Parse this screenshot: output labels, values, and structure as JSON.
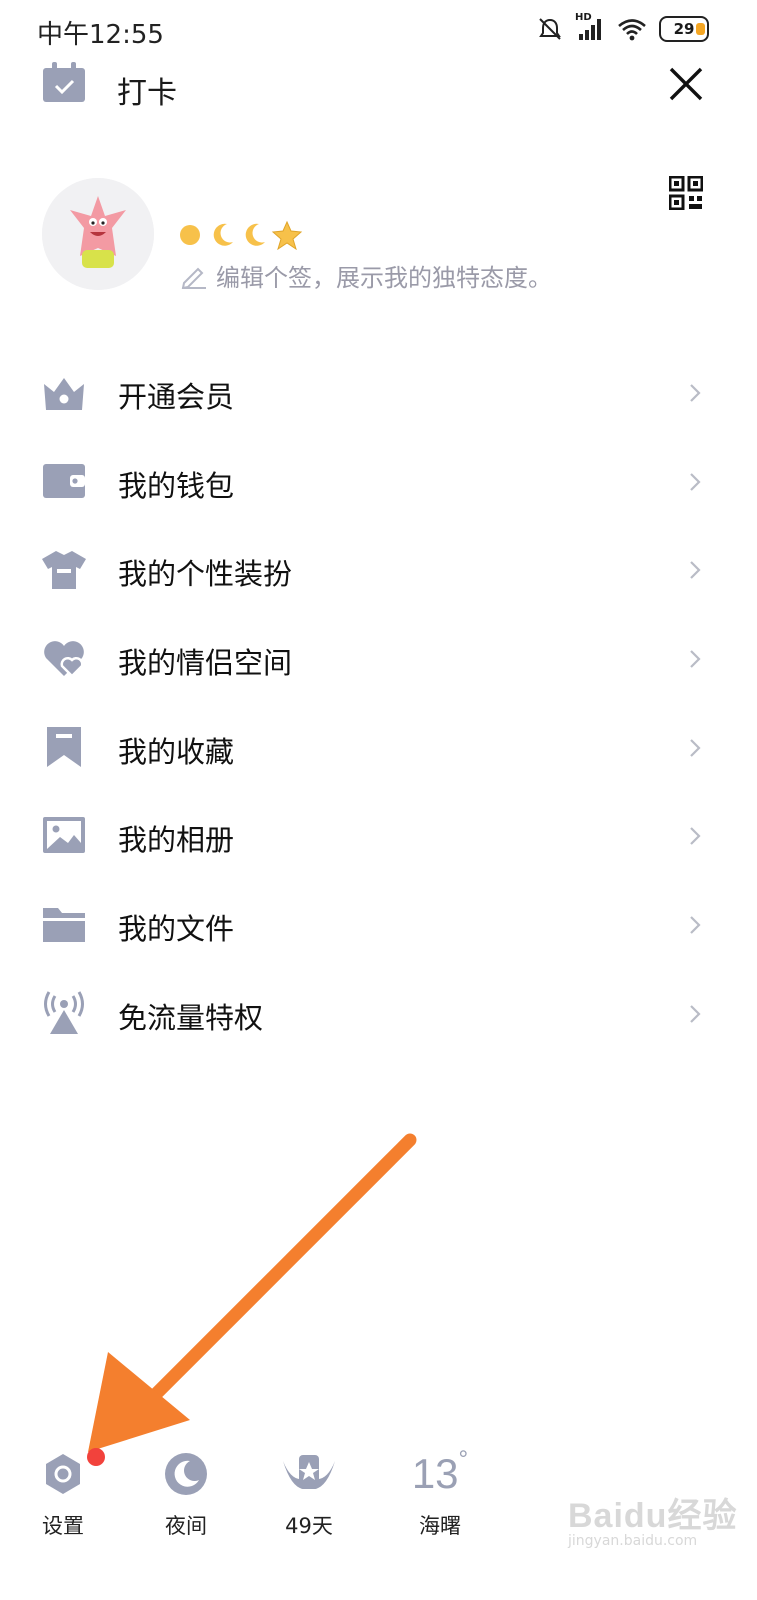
{
  "status_bar": {
    "time": "中午12:55",
    "network": "HD",
    "battery": "29"
  },
  "header": {
    "checkin_label": "打卡"
  },
  "profile": {
    "signature_placeholder": "编辑个签，展示我的独特态度。"
  },
  "menu": {
    "items": [
      {
        "label": "开通会员",
        "icon": "crown-icon"
      },
      {
        "label": "我的钱包",
        "icon": "wallet-icon"
      },
      {
        "label": "我的个性装扮",
        "icon": "shirt-icon"
      },
      {
        "label": "我的情侣空间",
        "icon": "hearts-icon"
      },
      {
        "label": "我的收藏",
        "icon": "bookmark-icon"
      },
      {
        "label": "我的相册",
        "icon": "photo-icon"
      },
      {
        "label": "我的文件",
        "icon": "folder-icon"
      },
      {
        "label": "免流量特权",
        "icon": "antenna-icon"
      }
    ]
  },
  "bottom_bar": {
    "settings_label": "设置",
    "night_label": "夜间",
    "days_label": "49天",
    "temperature": "13",
    "weather_label": "海曙"
  },
  "watermark": {
    "brand": "Baidu经验",
    "url": "jingyan.baidu.com"
  },
  "colors": {
    "icon_gray": "#9aa0b6",
    "arrow": "#f47f2e",
    "badge": "#f2423c"
  }
}
